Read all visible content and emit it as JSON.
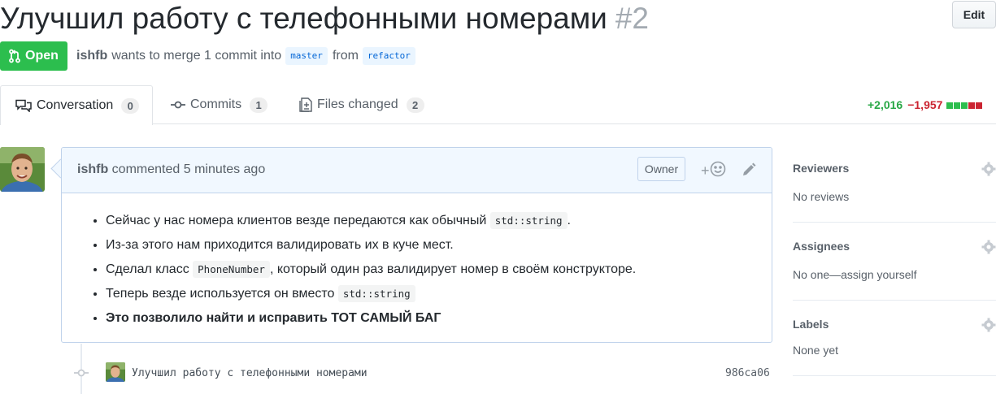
{
  "pull_request": {
    "title": "Улучшил работу с телефонными номерами",
    "number": "#2",
    "state": "Open",
    "author": "ishfb",
    "merge_text_1": "wants to merge 1 commit into",
    "base_branch": "master",
    "from_text": "from",
    "head_branch": "refactor"
  },
  "header": {
    "edit_label": "Edit"
  },
  "tabs": [
    {
      "label": "Conversation",
      "count": "0",
      "icon": "comment-discussion-icon"
    },
    {
      "label": "Commits",
      "count": "1",
      "icon": "git-commit-icon"
    },
    {
      "label": "Files changed",
      "count": "2",
      "icon": "diff-icon"
    }
  ],
  "diffstat": {
    "additions": "+2,016",
    "deletions": "−1,957",
    "blocks": [
      "add",
      "add",
      "add",
      "del",
      "del"
    ],
    "colors": {
      "add": "#2cbe4e",
      "del": "#cb2431",
      "neutral": "#d1d5da"
    }
  },
  "comment": {
    "author": "ishfb",
    "action": "commented",
    "time": "5 minutes ago",
    "role_badge": "Owner",
    "reaction_plus": "+",
    "items": [
      {
        "before": "Сейчас у нас номера клиентов везде передаются как обычный ",
        "code": "std::string",
        "after": "."
      },
      {
        "before": "Из-за этого нам приходится валидировать их в куче мест.",
        "code": "",
        "after": ""
      },
      {
        "before": "Сделал класс ",
        "code": "PhoneNumber",
        "after": ", который один раз валидирует номер в своём конструкторе."
      },
      {
        "before": "Теперь везде используется он вместо ",
        "code": "std::string",
        "after": ""
      },
      {
        "before": "Это позволило найти и исправить ТОТ САМЫЙ БАГ",
        "code": "",
        "after": ""
      }
    ]
  },
  "timeline": {
    "commit_message": "Улучшил работу с телефонными номерами",
    "commit_sha": "986ca06"
  },
  "sidebar": {
    "reviewers": {
      "title": "Reviewers",
      "value": "No reviews"
    },
    "assignees": {
      "title": "Assignees",
      "value": "No one—assign yourself"
    },
    "labels": {
      "title": "Labels",
      "value": "None yet"
    }
  },
  "colors": {
    "open_green": "#2cbe4e",
    "link_blue": "#0366d6",
    "comment_header_bg": "#f1f8ff",
    "comment_border": "#c0d3eb"
  }
}
